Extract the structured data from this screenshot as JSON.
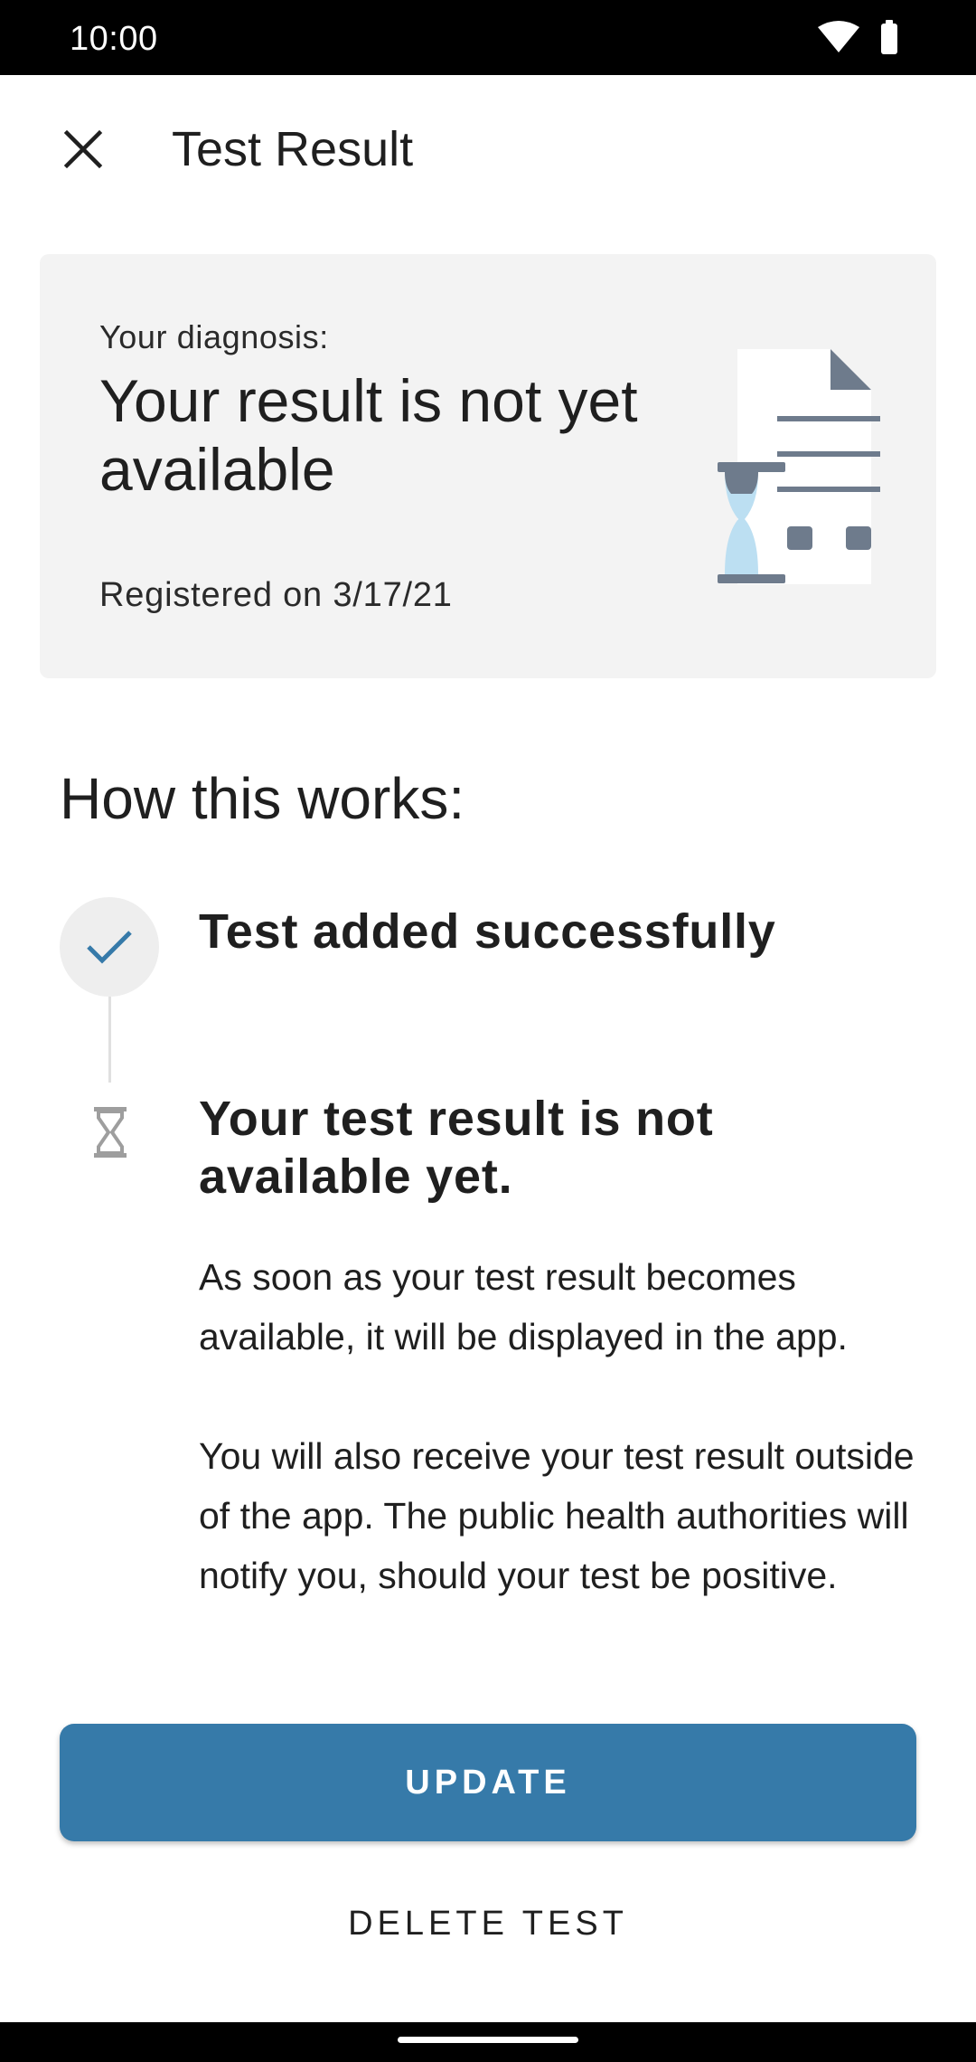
{
  "status_bar": {
    "time": "10:00",
    "icons": [
      "wifi-icon",
      "battery-icon"
    ]
  },
  "toolbar": {
    "close_icon": "close-icon",
    "title": "Test Result"
  },
  "card": {
    "label": "Your diagnosis:",
    "title": "Your result is not yet available",
    "date": "Registered on 3/17/21",
    "illustration": "document-hourglass-illustration"
  },
  "how": {
    "title": "How this works:"
  },
  "steps": [
    {
      "icon": "checkmark-icon",
      "title": "Test added successfully"
    },
    {
      "icon": "hourglass-icon",
      "title": "Your test result is not available yet.",
      "body": [
        "As soon as your test result becomes available, it will be displayed in the app.",
        "You will also receive your test result outside of the app. The public health authorities will notify you, should your test be positive."
      ]
    }
  ],
  "actions": {
    "update_label": "UPDATE",
    "delete_label": "DELETE TEST"
  },
  "colors": {
    "accent": "#367aa9",
    "card_background": "#f3f3f3",
    "illustration_grey": "#6e7b8c",
    "illustration_blue": "#bcdff2"
  }
}
